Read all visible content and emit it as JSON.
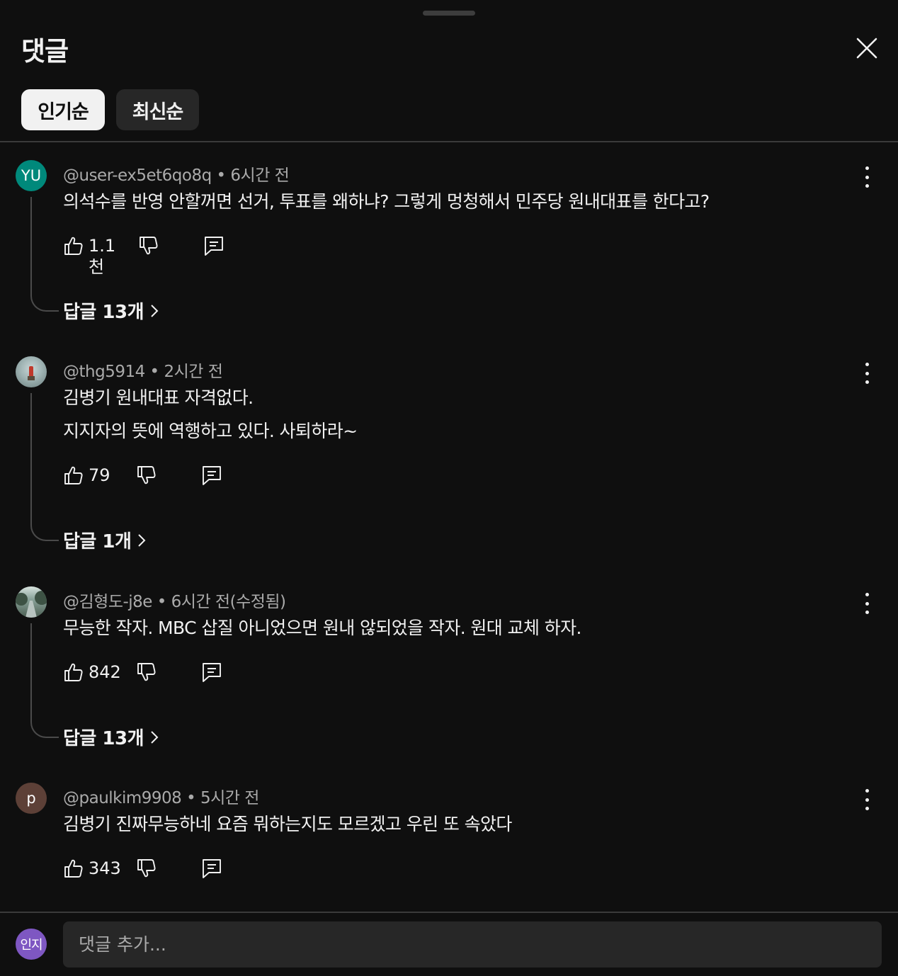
{
  "header": {
    "title": "댓글"
  },
  "sort_chips": [
    {
      "label": "인기순"
    },
    {
      "label": "최신순"
    }
  ],
  "comments": [
    {
      "avatar_text": "YU",
      "avatar_color": "#00897b",
      "author": "@user-ex5et6qo8q",
      "separator": "•",
      "time": "6시간 전",
      "lines": [
        "의석수를 반영 안할꺼면 선거, 투표를 왜하냐? 그렇게 멍청해서 민주당 원내대표를 한다고?"
      ],
      "likes": "1.1천",
      "replies_label": "답글 13개"
    },
    {
      "avatar_text": "",
      "avatar_color": "#8a9a9a",
      "author": "@thg5914",
      "separator": "•",
      "time": "2시간 전",
      "lines": [
        "김병기 원내대표 자격없다.",
        "지지자의 뜻에 역행하고 있다.  사퇴하라~"
      ],
      "likes": "79",
      "replies_label": "답글 1개"
    },
    {
      "avatar_text": "",
      "avatar_color": "#6f7f7a",
      "author": "@김형도-j8e",
      "separator": "•",
      "time": "6시간 전(수정됨)",
      "lines": [
        "무능한 작자. MBC  삽질 아니었으면 원내 않되었을 작자. 원대 교체 하자."
      ],
      "likes": "842",
      "replies_label": "답글 13개"
    },
    {
      "avatar_text": "p",
      "avatar_color": "#5d4037",
      "author": "@paulkim9908",
      "separator": "•",
      "time": "5시간 전",
      "lines": [
        "김병기 진짜무능하네 요즘 뭐하는지도 모르겠고 우린 또 속았다"
      ],
      "likes": "343"
    }
  ],
  "composer": {
    "avatar_text": "인지",
    "avatar_color": "#7e57c2",
    "placeholder": "댓글 추가..."
  },
  "icons": {
    "close": "close-icon",
    "like": "thumbs-up-icon",
    "dislike": "thumbs-down-icon",
    "reply": "reply-icon",
    "more": "more-vert-icon",
    "chevron": "chevron-right-icon"
  }
}
